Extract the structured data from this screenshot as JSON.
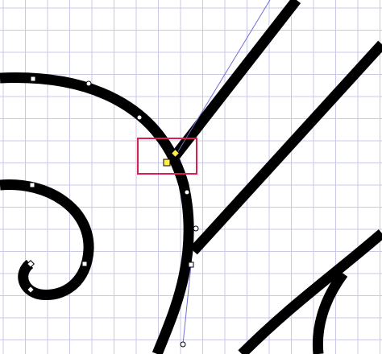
{
  "colors": {
    "background": "#ffffff",
    "grid_line": "#c8c8e8",
    "stroke": "#000000",
    "guide_line": "#7070d8",
    "selection_box": "#d8204a",
    "selected_node_fill": "#ffee44",
    "node_fill": "#ffffff",
    "node_outline": "#000000"
  },
  "icons": {
    "square_node": "square-node-handle",
    "circle_node": "bezier-control-handle",
    "diamond_node": "diamond-node-handle"
  }
}
